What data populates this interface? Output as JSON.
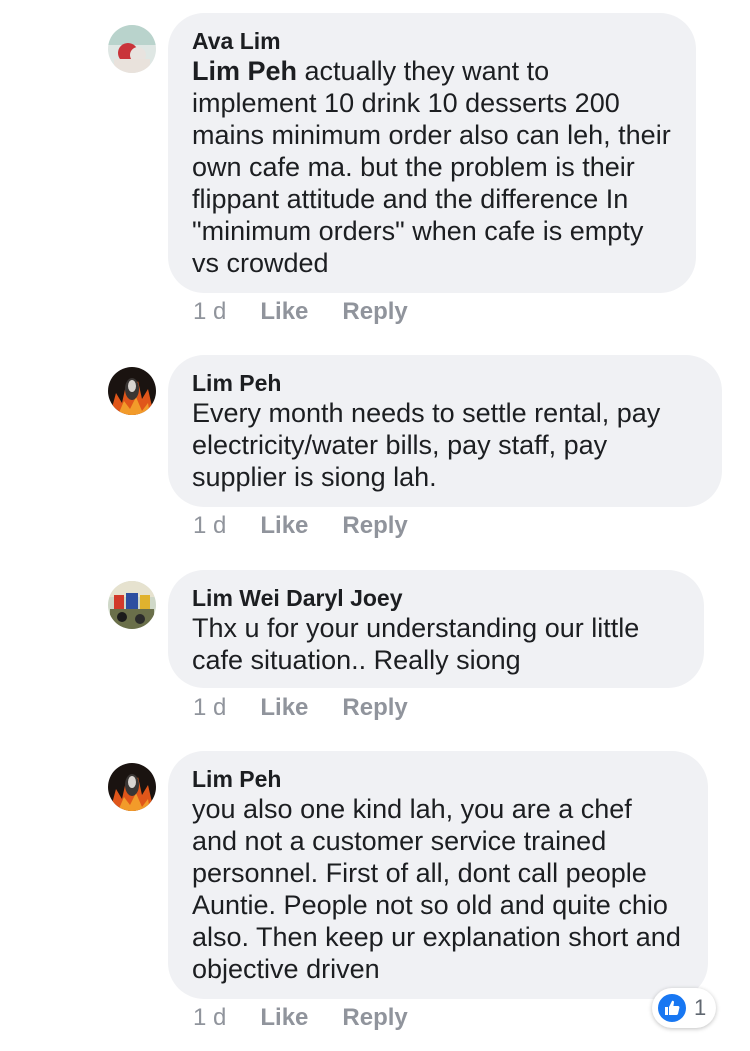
{
  "comments": [
    {
      "author": "Ava Lim",
      "mention": "Lim Peh",
      "text": " actually they want to implement 10 drink 10 desserts 200 mains minimum order also can leh, their own cafe ma. but the problem is their flippant attitude and the difference In \"minimum orders\" when cafe is empty vs crowded",
      "time": "1 d",
      "like_label": "Like",
      "reply_label": "Reply"
    },
    {
      "author": "Lim Peh",
      "text": "Every month needs to settle rental, pay electricity/water bills, pay staff, pay supplier is siong lah.",
      "time": "1 d",
      "like_label": "Like",
      "reply_label": "Reply"
    },
    {
      "author": "Lim Wei Daryl Joey",
      "text": "Thx u for your understanding our little cafe situation.. Really siong",
      "time": "1 d",
      "like_label": "Like",
      "reply_label": "Reply"
    },
    {
      "author": "Lim Peh",
      "text": "you also one kind lah, you are a chef and not a customer service trained personnel. First of all, dont call people Auntie. People not so old and quite chio also. Then keep ur explanation short and objective driven",
      "time": "1 d",
      "like_label": "Like",
      "reply_label": "Reply",
      "reaction": {
        "icon": "thumbs-up-icon",
        "count": "1"
      }
    }
  ],
  "colors": {
    "bubble": "#f0f1f4",
    "text": "#1c1e21",
    "meta": "#90949c",
    "like_blue": "#1877f2"
  }
}
